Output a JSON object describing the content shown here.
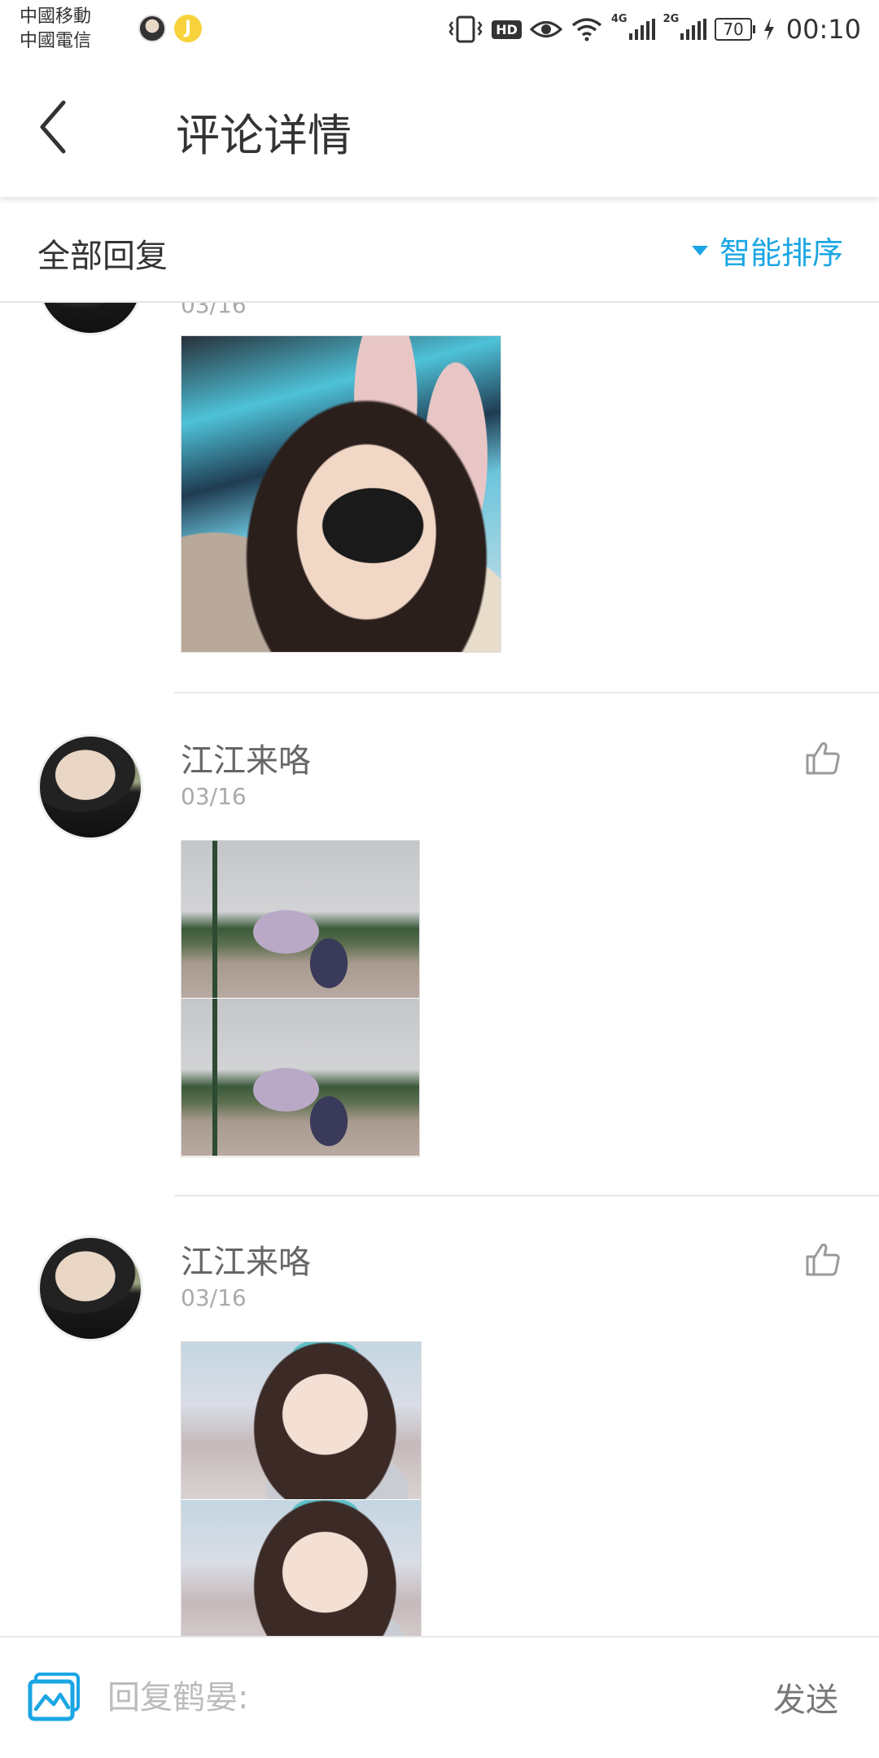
{
  "status_bar": {
    "carrier_1": "中國移動",
    "carrier_2": "中國電信",
    "notification_badge": "J",
    "hd_label": "HD",
    "net_1": "4G",
    "net_2": "2G",
    "battery": "70",
    "time": "00:10"
  },
  "header": {
    "title": "评论详情"
  },
  "section": {
    "all_replies_label": "全部回复",
    "sort_label": "智能排序",
    "accent_color": "#1aa6e4"
  },
  "replies": [
    {
      "date": "03/16"
    },
    {
      "nickname": "江江来咯",
      "date": "03/16"
    },
    {
      "nickname": "江江来咯",
      "date": "03/16"
    }
  ],
  "composer": {
    "placeholder": "回复鹤晏:",
    "send_label": "发送"
  }
}
